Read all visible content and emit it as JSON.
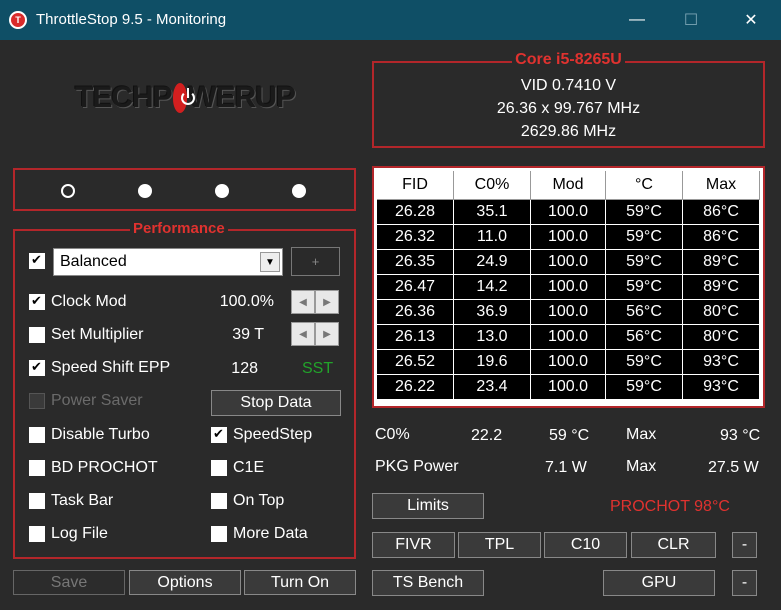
{
  "window": {
    "title": "ThrottleStop 9.5 - Monitoring",
    "app_icon": "T",
    "minimize": "—",
    "maximize": "☐",
    "close": "✕"
  },
  "logo": {
    "prefix": "TECHP",
    "suffix": "WERUP"
  },
  "profiles": {
    "selected_index": 0,
    "count": 4
  },
  "performance": {
    "label": "Performance",
    "profile_enabled": true,
    "profile_select": "Balanced",
    "plus_label": "+",
    "clock_mod": {
      "label": "Clock Mod",
      "checked": true,
      "value": "100.0%"
    },
    "set_multiplier": {
      "label": "Set Multiplier",
      "checked": false,
      "value": "39 T"
    },
    "speed_shift": {
      "label": "Speed Shift EPP",
      "checked": true,
      "value": "128",
      "badge": "SST"
    },
    "power_saver": {
      "label": "Power Saver",
      "checked": false,
      "disabled": true
    },
    "stop_data": "Stop Data",
    "disable_turbo": {
      "label": "Disable Turbo",
      "checked": false
    },
    "speedstep": {
      "label": "SpeedStep",
      "checked": true
    },
    "bd_prochot": {
      "label": "BD PROCHOT",
      "checked": false
    },
    "c1e": {
      "label": "C1E",
      "checked": false
    },
    "task_bar": {
      "label": "Task Bar",
      "checked": false
    },
    "on_top": {
      "label": "On Top",
      "checked": false
    },
    "log_file": {
      "label": "Log File",
      "checked": false
    },
    "more_data": {
      "label": "More Data",
      "checked": false
    }
  },
  "bottom_left": {
    "save": "Save",
    "options": "Options",
    "turn_on": "Turn On"
  },
  "core": {
    "title": "Core i5-8265U",
    "vid": "VID  0.7410 V",
    "multiplier": "26.36 x 99.767 MHz",
    "freq": "2629.86 MHz"
  },
  "table": {
    "headers": [
      "FID",
      "C0%",
      "Mod",
      "°C",
      "Max"
    ],
    "rows": [
      [
        "26.28",
        "35.1",
        "100.0",
        "59°C",
        "86°C"
      ],
      [
        "26.32",
        "11.0",
        "100.0",
        "59°C",
        "86°C"
      ],
      [
        "26.35",
        "24.9",
        "100.0",
        "59°C",
        "89°C"
      ],
      [
        "26.47",
        "14.2",
        "100.0",
        "59°C",
        "89°C"
      ],
      [
        "26.36",
        "36.9",
        "100.0",
        "56°C",
        "80°C"
      ],
      [
        "26.13",
        "13.0",
        "100.0",
        "56°C",
        "80°C"
      ],
      [
        "26.52",
        "19.6",
        "100.0",
        "59°C",
        "93°C"
      ],
      [
        "26.22",
        "23.4",
        "100.0",
        "59°C",
        "93°C"
      ]
    ]
  },
  "stats": {
    "c0_label": "C0%",
    "c0_value": "22.2",
    "temp_value": "59 °C",
    "max_label_1": "Max",
    "max_temp": "93 °C",
    "pkg_label": "PKG Power",
    "pkg_value": "7.1 W",
    "max_label_2": "Max",
    "pkg_max": "27.5 W"
  },
  "right_buttons": {
    "limits": "Limits",
    "prochot": "PROCHOT 98°C",
    "fivr": "FIVR",
    "tpl": "TPL",
    "c10": "C10",
    "clr": "CLR",
    "dash1": "-",
    "ts_bench": "TS Bench",
    "gpu": "GPU",
    "dash2": "-"
  }
}
